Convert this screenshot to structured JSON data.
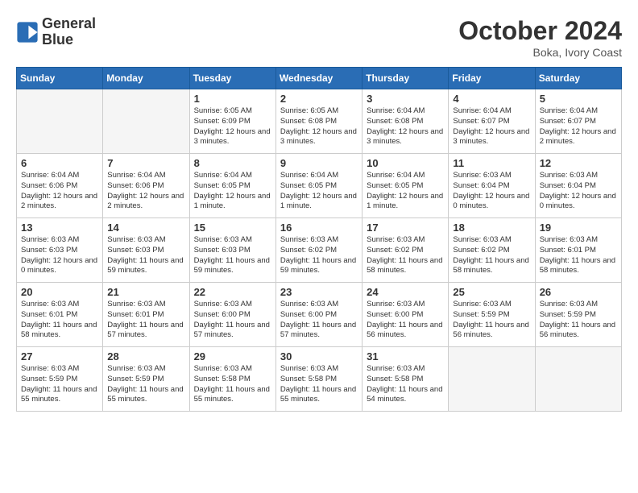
{
  "header": {
    "logo_line1": "General",
    "logo_line2": "Blue",
    "month": "October 2024",
    "location": "Boka, Ivory Coast"
  },
  "weekdays": [
    "Sunday",
    "Monday",
    "Tuesday",
    "Wednesday",
    "Thursday",
    "Friday",
    "Saturday"
  ],
  "weeks": [
    [
      {
        "day": "",
        "empty": true
      },
      {
        "day": "",
        "empty": true
      },
      {
        "day": "1",
        "sunrise": "6:05 AM",
        "sunset": "6:09 PM",
        "daylight": "12 hours and 3 minutes."
      },
      {
        "day": "2",
        "sunrise": "6:05 AM",
        "sunset": "6:08 PM",
        "daylight": "12 hours and 3 minutes."
      },
      {
        "day": "3",
        "sunrise": "6:04 AM",
        "sunset": "6:08 PM",
        "daylight": "12 hours and 3 minutes."
      },
      {
        "day": "4",
        "sunrise": "6:04 AM",
        "sunset": "6:07 PM",
        "daylight": "12 hours and 3 minutes."
      },
      {
        "day": "5",
        "sunrise": "6:04 AM",
        "sunset": "6:07 PM",
        "daylight": "12 hours and 2 minutes."
      }
    ],
    [
      {
        "day": "6",
        "sunrise": "6:04 AM",
        "sunset": "6:06 PM",
        "daylight": "12 hours and 2 minutes."
      },
      {
        "day": "7",
        "sunrise": "6:04 AM",
        "sunset": "6:06 PM",
        "daylight": "12 hours and 2 minutes."
      },
      {
        "day": "8",
        "sunrise": "6:04 AM",
        "sunset": "6:05 PM",
        "daylight": "12 hours and 1 minute."
      },
      {
        "day": "9",
        "sunrise": "6:04 AM",
        "sunset": "6:05 PM",
        "daylight": "12 hours and 1 minute."
      },
      {
        "day": "10",
        "sunrise": "6:04 AM",
        "sunset": "6:05 PM",
        "daylight": "12 hours and 1 minute."
      },
      {
        "day": "11",
        "sunrise": "6:03 AM",
        "sunset": "6:04 PM",
        "daylight": "12 hours and 0 minutes."
      },
      {
        "day": "12",
        "sunrise": "6:03 AM",
        "sunset": "6:04 PM",
        "daylight": "12 hours and 0 minutes."
      }
    ],
    [
      {
        "day": "13",
        "sunrise": "6:03 AM",
        "sunset": "6:03 PM",
        "daylight": "12 hours and 0 minutes."
      },
      {
        "day": "14",
        "sunrise": "6:03 AM",
        "sunset": "6:03 PM",
        "daylight": "11 hours and 59 minutes."
      },
      {
        "day": "15",
        "sunrise": "6:03 AM",
        "sunset": "6:03 PM",
        "daylight": "11 hours and 59 minutes."
      },
      {
        "day": "16",
        "sunrise": "6:03 AM",
        "sunset": "6:02 PM",
        "daylight": "11 hours and 59 minutes."
      },
      {
        "day": "17",
        "sunrise": "6:03 AM",
        "sunset": "6:02 PM",
        "daylight": "11 hours and 58 minutes."
      },
      {
        "day": "18",
        "sunrise": "6:03 AM",
        "sunset": "6:02 PM",
        "daylight": "11 hours and 58 minutes."
      },
      {
        "day": "19",
        "sunrise": "6:03 AM",
        "sunset": "6:01 PM",
        "daylight": "11 hours and 58 minutes."
      }
    ],
    [
      {
        "day": "20",
        "sunrise": "6:03 AM",
        "sunset": "6:01 PM",
        "daylight": "11 hours and 58 minutes."
      },
      {
        "day": "21",
        "sunrise": "6:03 AM",
        "sunset": "6:01 PM",
        "daylight": "11 hours and 57 minutes."
      },
      {
        "day": "22",
        "sunrise": "6:03 AM",
        "sunset": "6:00 PM",
        "daylight": "11 hours and 57 minutes."
      },
      {
        "day": "23",
        "sunrise": "6:03 AM",
        "sunset": "6:00 PM",
        "daylight": "11 hours and 57 minutes."
      },
      {
        "day": "24",
        "sunrise": "6:03 AM",
        "sunset": "6:00 PM",
        "daylight": "11 hours and 56 minutes."
      },
      {
        "day": "25",
        "sunrise": "6:03 AM",
        "sunset": "5:59 PM",
        "daylight": "11 hours and 56 minutes."
      },
      {
        "day": "26",
        "sunrise": "6:03 AM",
        "sunset": "5:59 PM",
        "daylight": "11 hours and 56 minutes."
      }
    ],
    [
      {
        "day": "27",
        "sunrise": "6:03 AM",
        "sunset": "5:59 PM",
        "daylight": "11 hours and 55 minutes."
      },
      {
        "day": "28",
        "sunrise": "6:03 AM",
        "sunset": "5:59 PM",
        "daylight": "11 hours and 55 minutes."
      },
      {
        "day": "29",
        "sunrise": "6:03 AM",
        "sunset": "5:58 PM",
        "daylight": "11 hours and 55 minutes."
      },
      {
        "day": "30",
        "sunrise": "6:03 AM",
        "sunset": "5:58 PM",
        "daylight": "11 hours and 55 minutes."
      },
      {
        "day": "31",
        "sunrise": "6:03 AM",
        "sunset": "5:58 PM",
        "daylight": "11 hours and 54 minutes."
      },
      {
        "day": "",
        "empty": true
      },
      {
        "day": "",
        "empty": true
      }
    ]
  ]
}
